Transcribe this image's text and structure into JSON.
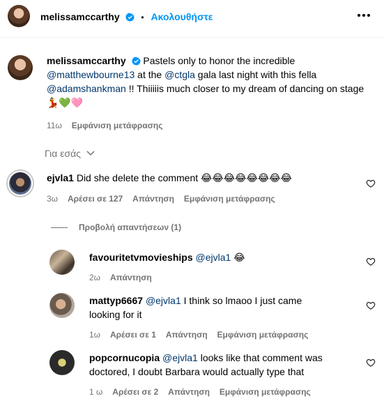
{
  "header": {
    "username": "melissamccarthy",
    "separator": "•",
    "follow_label": "Ακολουθήστε",
    "more_icon": "more-horizontal-icon"
  },
  "caption": {
    "username": "melissamccarthy",
    "text_1": "Pastels only to honor the incredible",
    "mention_1": "@matthewbourne13",
    "text_2": " at the ",
    "mention_2": "@ctgla",
    "text_3": " gala last night with this fella",
    "mention_3": "@adamshankman",
    "text_4": " !! Thiiiiis much closer to my dream of dancing on stage ",
    "emojis": "💃💚🩷",
    "time": "11ω",
    "translate": "Εμφάνιση μετάφρασης"
  },
  "for_you": {
    "label": "Για εσάς",
    "icon": "chevron-down-icon"
  },
  "comments": [
    {
      "username": "ejvla1",
      "text": "Did she delete the comment",
      "emojis": "😂😂😂😂😂😂😂😂",
      "time": "3ω",
      "likes": "Αρέσει σε 127",
      "reply": "Απάντηση",
      "translate": "Εμφάνιση μετάφρασης"
    }
  ],
  "view_replies": "Προβολή απαντήσεων (1)",
  "replies": [
    {
      "username": "favouritetvmovieships",
      "mention": "@ejvla1",
      "text": "",
      "emojis": "😂",
      "time": "2ω",
      "reply": "Απάντηση"
    },
    {
      "username": "mattyp6667",
      "mention": "@ejvla1",
      "text_line1": " I think so lmaoo I just came",
      "text_line2": "looking for it",
      "time": "1ω",
      "likes": "Αρέσει σε 1",
      "reply": "Απάντηση",
      "translate": "Εμφάνιση μετάφρασης"
    },
    {
      "username": "popcornucopia",
      "mention": "@ejvla1",
      "text_line1": " looks like that comment was",
      "text_line2": "doctored, I doubt Barbara would actually type that",
      "time": "1 ω",
      "likes": "Αρέσει σε 2",
      "reply": "Απάντηση",
      "translate": "Εμφάνιση μετάφρασης"
    }
  ],
  "colors": {
    "follow_blue": "#0095f6",
    "mention_navy": "#00376b",
    "meta_gray": "#737373",
    "verified_blue": "#0095f6"
  }
}
